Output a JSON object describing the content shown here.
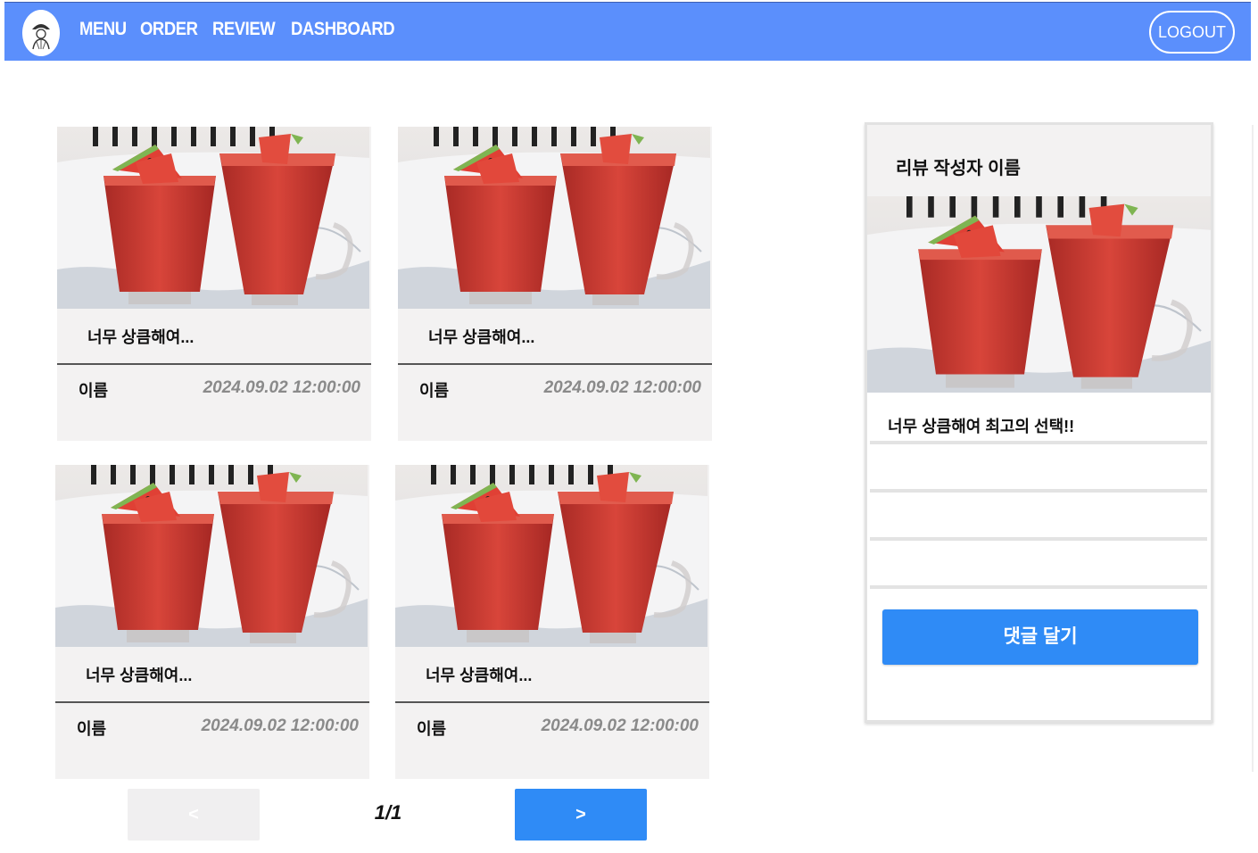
{
  "nav": {
    "links": [
      "MENU",
      "ORDER",
      "REVIEW",
      "DASHBOARD"
    ],
    "logout": "LOGOUT",
    "brand_color": "#5b8ffc"
  },
  "reviews": [
    {
      "title": "너무 상큼해여...",
      "author": "이름",
      "date": "2024.09.02 12:00:00"
    },
    {
      "title": "너무 상큼해여...",
      "author": "이름",
      "date": "2024.09.02 12:00:00"
    },
    {
      "title": "너무 상큼해여...",
      "author": "이름",
      "date": "2024.09.02 12:00:00"
    },
    {
      "title": "너무 상큼해여...",
      "author": "이름",
      "date": "2024.09.02 12:00:00"
    }
  ],
  "pagination": {
    "prev": "<",
    "current": "1/1",
    "next": ">"
  },
  "detail": {
    "author": "리뷰 작성자 이름",
    "content": "너무 상큼해여 최고의 선택!!",
    "comment_button": "댓글 달기",
    "accent_color": "#2f8bf6"
  }
}
